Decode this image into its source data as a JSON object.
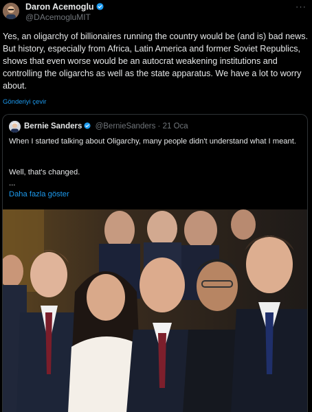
{
  "author": {
    "name": "Daron Acemoglu",
    "handle": "@DAcemogluMIT",
    "avatar_icon": "person-avatar-icon",
    "verified_icon": "verified-badge-icon"
  },
  "more_menu": "···",
  "tweet_text": "Yes, an oligarchy of billionaires running the country would be (and is) bad news. But history, especially from Africa, Latin America and former Soviet Republics, shows that even worse would be an autocrat weakening institutions and controlling the oligarchs as well as the state apparatus. We have a lot to worry about.",
  "translate_link": "Gönderiyi çevir",
  "quoted": {
    "name": "Bernie Sanders",
    "handle": "@BernieSanders",
    "separator": "·",
    "date": "21 Oca",
    "text_para1": "When I started talking about Oligarchy, many people didn't understand what I meant.",
    "text_para2": "Well, that's changed.",
    "ellipsis": "...",
    "show_more": "Daha fazla göster",
    "media_icon": "photo-billionaires-row-icon"
  },
  "colors": {
    "background": "#000000",
    "text": "#e7e9ea",
    "muted": "#71767b",
    "link": "#1d9bf0",
    "border": "#2f3336"
  }
}
